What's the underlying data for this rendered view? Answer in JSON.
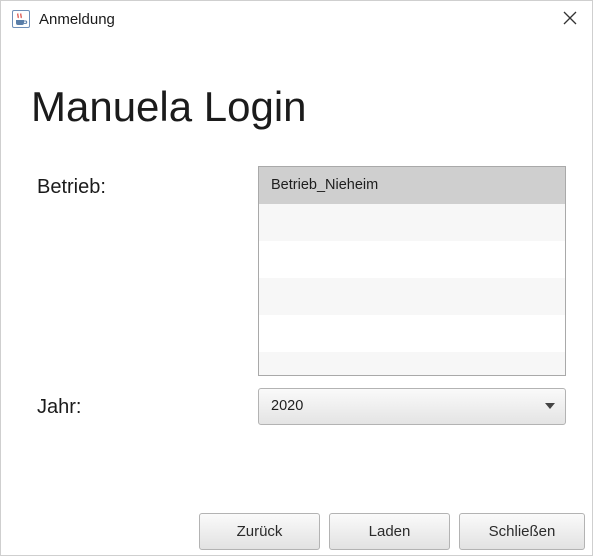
{
  "window": {
    "title": "Anmeldung",
    "icon": "java-coffee-cup-icon",
    "close_icon": "close-icon"
  },
  "heading": "Manuela Login",
  "form": {
    "betrieb_label": "Betrieb:",
    "betrieb_list": {
      "items": [
        "Betrieb_Nieheim",
        "",
        "",
        "",
        "",
        ""
      ],
      "selected_index": 0
    },
    "jahr_label": "Jahr:",
    "jahr_combo": {
      "value": "2020",
      "icon": "chevron-down-icon"
    }
  },
  "buttons": {
    "back": "Zurück",
    "load": "Laden",
    "close": "Schließen"
  },
  "colors": {
    "selected_row": "#cfcfcf",
    "alt_row": "#f7f7f7",
    "border": "#a9a9a9"
  }
}
